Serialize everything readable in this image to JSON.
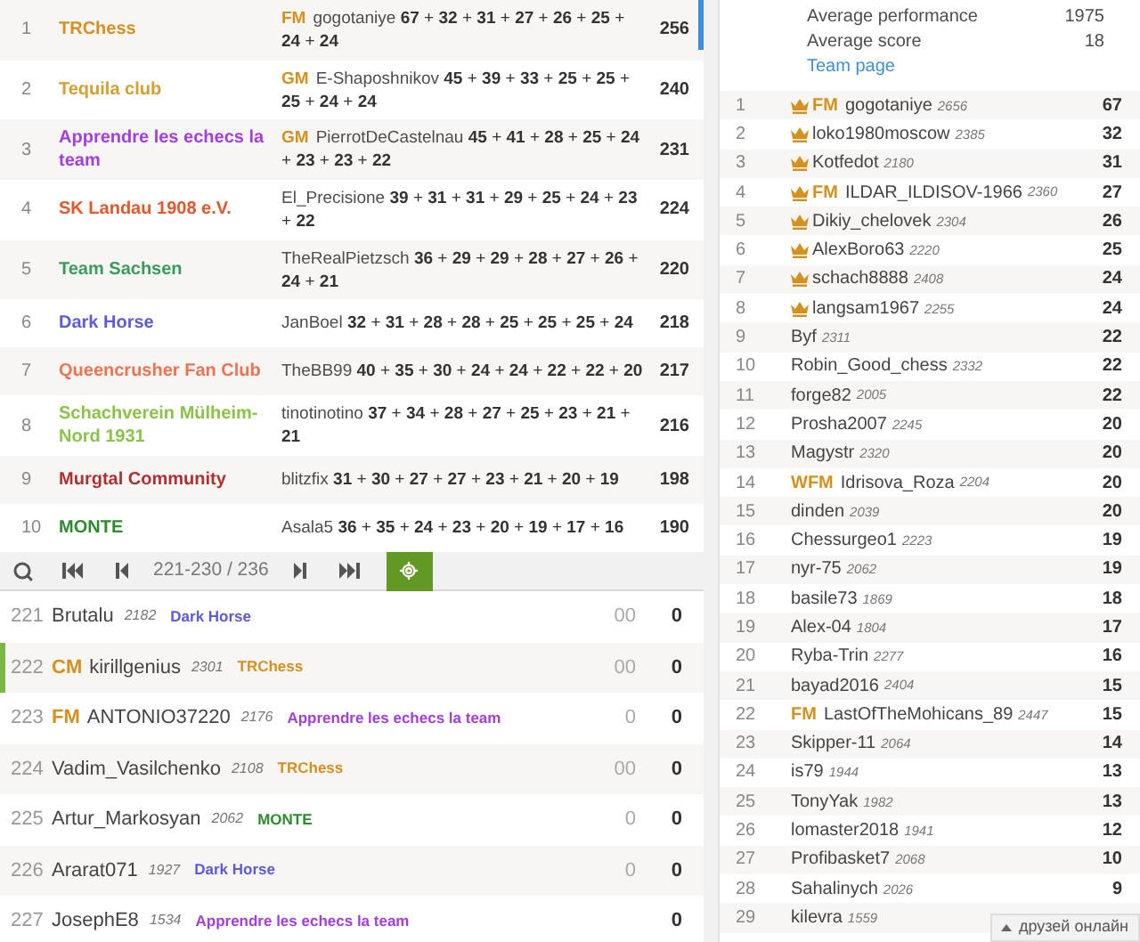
{
  "teams": [
    {
      "rank": "1",
      "name": "TRChess",
      "color": "#d59120",
      "leader": {
        "title": "FM",
        "name": "gogotaniye"
      },
      "scores": "**67** + **32** + **31** + **27** + **26** + **25** + **24** + **24**",
      "total": "256"
    },
    {
      "rank": "2",
      "name": "Tequila club",
      "color": "#d4a030",
      "leader": {
        "title": "GM",
        "name": "E-Shaposhnikov"
      },
      "scores": "**45** + **39** + **33** + **25** + **25** + **25** + **24** + **24**",
      "total": "240"
    },
    {
      "rank": "3",
      "name": "Apprendre les echecs la team",
      "color": "#a33ee0",
      "leader": {
        "title": "GM",
        "name": "PierrotDeCastelnau"
      },
      "scores": "**45** + **41** + **28** + **25** + **24** + **23** + **23** + **22**",
      "total": "231"
    },
    {
      "rank": "4",
      "name": "SK Landau 1908 e.V.",
      "color": "#e8562c",
      "leader": {
        "name": "El_Precisione"
      },
      "scores": "**39** + **31** + **31** + **29** + **25** + **24** + **23** + **22**",
      "total": "224"
    },
    {
      "rank": "5",
      "name": "Team Sachsen",
      "color": "#3a9b5a",
      "leader": {
        "name": "TheRealPietzsch"
      },
      "scores": "**36** + **29** + **29** + **28** + **27** + **26** + **24** + **21**",
      "total": "220"
    },
    {
      "rank": "6",
      "name": "Dark Horse",
      "color": "#5d5ae0",
      "leader": {
        "name": "JanBoel"
      },
      "scores": "**32** + **31** + **28** + **28** + **25** + **25** + **25** + **24**",
      "total": "218"
    },
    {
      "rank": "7",
      "name": "Queencrusher Fan Club",
      "color": "#ef7350",
      "leader": {
        "name": "TheBB99"
      },
      "scores": "**40** + **35** + **30** + **24** + **24** + **22** + **22** + **20**",
      "total": "217"
    },
    {
      "rank": "8",
      "name": "Schachverein Mülheim-Nord 1931",
      "color": "#8bc34a",
      "leader": {
        "name": "tinotinotino"
      },
      "scores": "**37** + **34** + **28** + **27** + **25** + **23** + **21** + **21**",
      "total": "216"
    },
    {
      "rank": "9",
      "name": "Murgtal Community",
      "color": "#b03030",
      "leader": {
        "name": "blitzfix"
      },
      "scores": "**31** + **30** + **27** + **27** + **23** + **21** + **20** + **19**",
      "total": "198"
    },
    {
      "rank": "10",
      "name": "MONTE",
      "color": "#2e8b2e",
      "leader": {
        "name": "Asala5"
      },
      "scores": "**36** + **35** + **24** + **23** + **20** + **19** + **17** + **16**",
      "total": "190"
    }
  ],
  "pager": {
    "range": "221-230 / 236"
  },
  "players": [
    {
      "rank": "221",
      "name": "Brutalu",
      "rating": "2182",
      "team": "Dark Horse",
      "color": "#5d5ae0",
      "sheet": "00",
      "points": "0",
      "selected": false
    },
    {
      "rank": "222",
      "title": "CM",
      "name": "kirillgenius",
      "rating": "2301",
      "team": "TRChess",
      "color": "#d59120",
      "sheet": "00",
      "points": "0",
      "selected": true
    },
    {
      "rank": "223",
      "title": "FM",
      "name": "ANTONIO37220",
      "rating": "2176",
      "team": "Apprendre les echecs la team",
      "color": "#a33ee0",
      "sheet": "0",
      "points": "0",
      "selected": false
    },
    {
      "rank": "224",
      "name": "Vadim_Vasilchenko",
      "rating": "2108",
      "team": "TRChess",
      "color": "#d59120",
      "sheet": "00",
      "points": "0",
      "selected": false
    },
    {
      "rank": "225",
      "name": "Artur_Markosyan",
      "rating": "2062",
      "team": "MONTE",
      "color": "#2e8b2e",
      "sheet": "0",
      "points": "0",
      "selected": false
    },
    {
      "rank": "226",
      "name": "Ararat071",
      "rating": "1927",
      "team": "Dark Horse",
      "color": "#5d5ae0",
      "sheet": "0",
      "points": "0",
      "selected": false
    },
    {
      "rank": "227",
      "name": "JosephE8",
      "rating": "1534",
      "team": "Apprendre les echecs la team",
      "color": "#a33ee0",
      "points": "0",
      "selected": false
    }
  ],
  "team_info": {
    "stats": [
      {
        "label": "Average performance",
        "value": "1975"
      },
      {
        "label": "Average score",
        "value": "18"
      }
    ],
    "link": "Team page"
  },
  "members": [
    {
      "rank": "1",
      "leader": true,
      "title": "FM",
      "name": "gogotaniye",
      "rating": "2656",
      "points": "67"
    },
    {
      "rank": "2",
      "leader": true,
      "name": "loko1980moscow",
      "rating": "2385",
      "points": "32"
    },
    {
      "rank": "3",
      "leader": true,
      "name": "Kotfedot",
      "rating": "2180",
      "points": "31"
    },
    {
      "rank": "4",
      "leader": true,
      "title": "FM",
      "name": "ILDAR_ILDISOV-1966",
      "rating": "2360",
      "points": "27"
    },
    {
      "rank": "5",
      "leader": true,
      "name": "Dikiy_chelovek",
      "rating": "2304",
      "points": "26"
    },
    {
      "rank": "6",
      "leader": true,
      "name": "AlexBoro63",
      "rating": "2220",
      "points": "25"
    },
    {
      "rank": "7",
      "leader": true,
      "name": "schach8888",
      "rating": "2408",
      "points": "24"
    },
    {
      "rank": "8",
      "leader": true,
      "name": "langsam1967",
      "rating": "2255",
      "points": "24"
    },
    {
      "rank": "9",
      "leader": false,
      "name": "Byf",
      "rating": "2311",
      "points": "22"
    },
    {
      "rank": "10",
      "leader": false,
      "name": "Robin_Good_chess",
      "rating": "2332",
      "points": "22"
    },
    {
      "rank": "11",
      "leader": false,
      "name": "forge82",
      "rating": "2005",
      "points": "22"
    },
    {
      "rank": "12",
      "leader": false,
      "name": "Prosha2007",
      "rating": "2245",
      "points": "20"
    },
    {
      "rank": "13",
      "leader": false,
      "name": "Magystr",
      "rating": "2320",
      "points": "20"
    },
    {
      "rank": "14",
      "leader": false,
      "title": "WFM",
      "name": "Idrisova_Roza",
      "rating": "2204",
      "points": "20"
    },
    {
      "rank": "15",
      "leader": false,
      "name": "dinden",
      "rating": "2039",
      "points": "20"
    },
    {
      "rank": "16",
      "leader": false,
      "name": "Chessurgeo1",
      "rating": "2223",
      "points": "19"
    },
    {
      "rank": "17",
      "leader": false,
      "name": "nyr-75",
      "rating": "2062",
      "points": "19"
    },
    {
      "rank": "18",
      "leader": false,
      "name": "basile73",
      "rating": "1869",
      "points": "18"
    },
    {
      "rank": "19",
      "leader": false,
      "name": "Alex-04",
      "rating": "1804",
      "points": "17"
    },
    {
      "rank": "20",
      "leader": false,
      "name": "Ryba-Trin",
      "rating": "2277",
      "points": "16"
    },
    {
      "rank": "21",
      "leader": false,
      "name": "bayad2016",
      "rating": "2404",
      "points": "15"
    },
    {
      "rank": "22",
      "leader": false,
      "title": "FM",
      "name": "LastOfTheMohicans_89",
      "rating": "2447",
      "points": "15"
    },
    {
      "rank": "23",
      "leader": false,
      "name": "Skipper-11",
      "rating": "2064",
      "points": "14"
    },
    {
      "rank": "24",
      "leader": false,
      "name": "is79",
      "rating": "1944",
      "points": "13"
    },
    {
      "rank": "25",
      "leader": false,
      "name": "TonyYak",
      "rating": "1982",
      "points": "13"
    },
    {
      "rank": "26",
      "leader": false,
      "name": "lomaster2018",
      "rating": "1941",
      "points": "12"
    },
    {
      "rank": "27",
      "leader": false,
      "name": "Profibasket7",
      "rating": "2068",
      "points": "10"
    },
    {
      "rank": "28",
      "leader": false,
      "name": "Sahalinych",
      "rating": "2026",
      "points": "9"
    },
    {
      "rank": "29",
      "leader": false,
      "name": "kilevra",
      "rating": "1559"
    }
  ],
  "friends_bar": {
    "label": "друзей онлайн"
  }
}
